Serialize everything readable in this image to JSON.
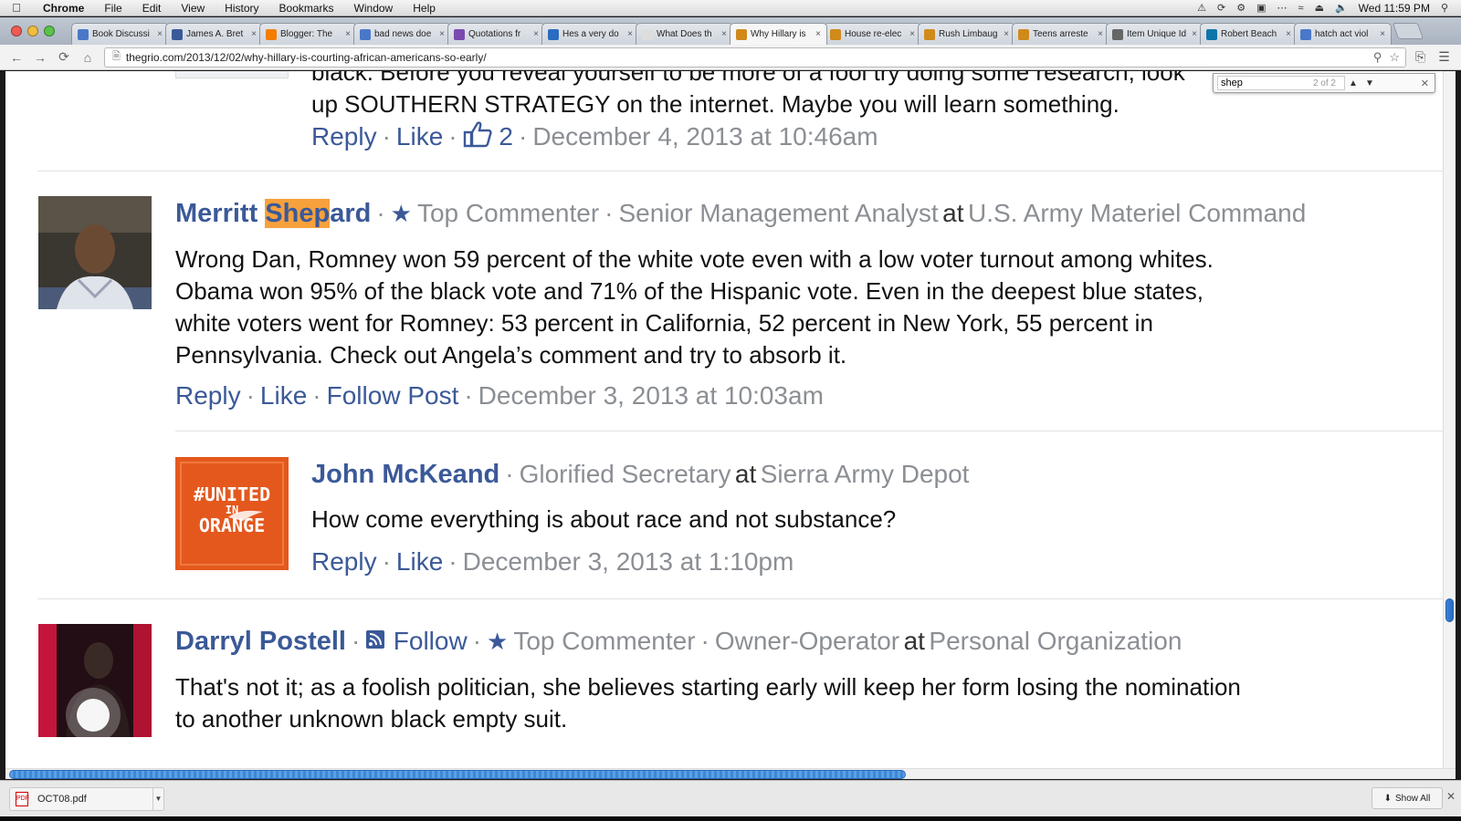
{
  "menubar": {
    "app": "Chrome",
    "items": [
      "File",
      "Edit",
      "View",
      "History",
      "Bookmarks",
      "Window",
      "Help"
    ],
    "clock": "Wed 11:59 PM"
  },
  "tabs": [
    {
      "label": "Book Discussi",
      "favicon": "page-icon",
      "color": "#4a78c8"
    },
    {
      "label": "James A. Bret",
      "favicon": "facebook-icon",
      "color": "#3b5998"
    },
    {
      "label": "Blogger: The",
      "favicon": "blogger-icon",
      "color": "#f57d00"
    },
    {
      "label": "bad news doe",
      "favicon": "google-icon",
      "color": "#4a78c8"
    },
    {
      "label": "Quotations fr",
      "favicon": "quote-icon",
      "color": "#7a4ab0"
    },
    {
      "label": "Hes a very do",
      "favicon": "page-icon",
      "color": "#2a6cc0"
    },
    {
      "label": "What Does th",
      "favicon": "blank-icon",
      "color": "#dddddd"
    },
    {
      "label": "Why Hillary is",
      "favicon": "grio-icon",
      "color": "#d08a1a",
      "active": true
    },
    {
      "label": "House re-elec",
      "favicon": "grio-icon",
      "color": "#d08a1a"
    },
    {
      "label": "Rush Limbaug",
      "favicon": "grio-icon",
      "color": "#d08a1a"
    },
    {
      "label": "Teens arreste",
      "favicon": "grio-icon",
      "color": "#d08a1a"
    },
    {
      "label": "Item Unique Id",
      "favicon": "wikipedia-icon",
      "color": "#666666"
    },
    {
      "label": "Robert Beach",
      "favicon": "linkedin-icon",
      "color": "#0e76a8"
    },
    {
      "label": "hatch act viol",
      "favicon": "google-icon",
      "color": "#4a78c8"
    }
  ],
  "address": {
    "url": "thegrio.com/2013/12/02/why-hillary-is-courting-african-americans-so-early/"
  },
  "find": {
    "query": "shep",
    "count": "2 of 2"
  },
  "accent": "#3b5998",
  "highlight_color": "#f7a13c",
  "prev_comment": {
    "partial_line": "black. Before you reveal yourself to be more of a fool try doing some research, look",
    "last_line": "up SOUTHERN STRATEGY on the internet. Maybe you will learn something.",
    "reply": "Reply",
    "like": "Like",
    "likes": "2",
    "date": "December 4, 2013 at 10:46am"
  },
  "comments": [
    {
      "name_before": "Merritt ",
      "name_highlight": "Shep",
      "name_after": "ard",
      "badge": "Top Commenter",
      "title": "Senior Management Analyst",
      "at": "at",
      "org": "U.S. Army Materiel Command",
      "body": [
        "Wrong Dan, Romney won 59 percent of the white vote even with a low voter turnout among whites.",
        "Obama won 95% of the black vote and 71% of the Hispanic vote. Even in the deepest blue states,",
        "white voters went for Romney: 53 percent in California, 52 percent in New York, 55 percent in",
        "Pennsylvania. Check out Angela’s comment and try to absorb it."
      ],
      "reply": "Reply",
      "like": "Like",
      "follow_post": "Follow Post",
      "date": "December 3, 2013 at 10:03am"
    },
    {
      "name": "John McKeand",
      "title": "Glorified Secretary",
      "at": "at",
      "org": "Sierra Army Depot",
      "avatar_text": [
        "#UNITED",
        "IN",
        "ORANGE"
      ],
      "body": "How come everything is about race and not substance?",
      "reply": "Reply",
      "like": "Like",
      "date": "December 3, 2013 at 1:10pm"
    },
    {
      "name": "Darryl Postell",
      "follow": "Follow",
      "badge": "Top Commenter",
      "title": "Owner-Operator",
      "at": "at",
      "org": "Personal Organization",
      "body": [
        "That's not it; as a foolish politician, she believes starting early will keep her form losing the nomination",
        "to another unknown black empty suit."
      ]
    }
  ],
  "downloads": {
    "file": "OCT08.pdf",
    "show_all": "Show All"
  }
}
